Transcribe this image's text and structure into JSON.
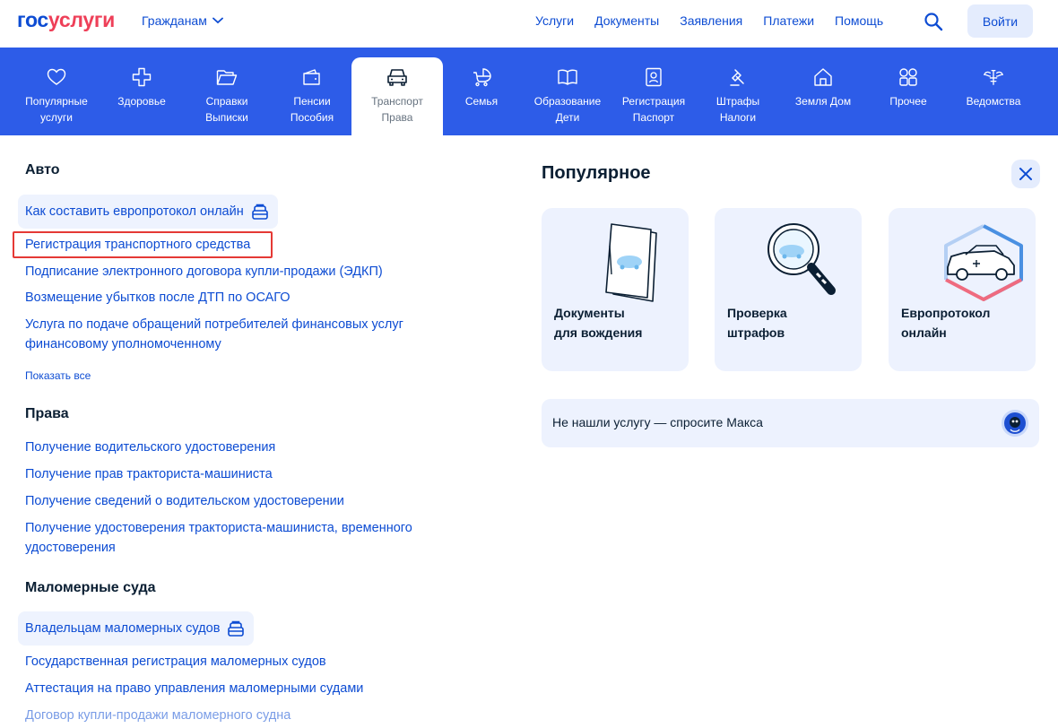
{
  "header": {
    "logo_part1": "гос",
    "logo_part2": "услуги",
    "audience": "Гражданам",
    "nav": [
      "Услуги",
      "Документы",
      "Заявления",
      "Платежи",
      "Помощь"
    ],
    "login": "Войти"
  },
  "categories": [
    {
      "line1": "Популярные",
      "line2": "услуги",
      "icon": "heart-icon"
    },
    {
      "line1": "Здоровье",
      "line2": "",
      "icon": "medical-cross-icon"
    },
    {
      "line1": "Справки",
      "line2": "Выписки",
      "icon": "folder-icon"
    },
    {
      "line1": "Пенсии",
      "line2": "Пособия",
      "icon": "wallet-icon"
    },
    {
      "line1": "Транспорт",
      "line2": "Права",
      "icon": "car-icon",
      "active": true
    },
    {
      "line1": "Семья",
      "line2": "",
      "icon": "stroller-icon"
    },
    {
      "line1": "Образование",
      "line2": "Дети",
      "icon": "book-icon"
    },
    {
      "line1": "Регистрация",
      "line2": "Паспорт",
      "icon": "passport-icon"
    },
    {
      "line1": "Штрафы",
      "line2": "Налоги",
      "icon": "gavel-icon"
    },
    {
      "line1": "Земля Дом",
      "line2": "",
      "icon": "house-icon"
    },
    {
      "line1": "Прочее",
      "line2": "",
      "icon": "grid-icon"
    },
    {
      "line1": "Ведомства",
      "line2": "",
      "icon": "emblem-icon"
    }
  ],
  "auto": {
    "title": "Авто",
    "chip": "Как составить европротокол онлайн",
    "links": [
      "Регистрация транспортного средства",
      "Подписание электронного договора купли-продажи (ЭДКП)",
      "Возмещение убытков после ДТП по ОСАГО",
      "Услуга по подаче обращений потребителей финансовых услуг",
      "финансовому уполномоченному"
    ],
    "show_all": "Показать все"
  },
  "rights": {
    "title": "Права",
    "links": [
      "Получение водительского удостоверения",
      "Получение прав тракториста-машиниста",
      "Получение сведений о водительском удостоверении",
      "Получение удостоверения тракториста-машиниста, временного",
      "удостоверения"
    ]
  },
  "boats": {
    "title": "Маломерные суда",
    "chip": "Владельцам маломерных судов",
    "links": [
      "Государственная регистрация маломерных судов",
      "Аттестация на право управления маломерными судами",
      "Договор купли-продажи маломерного судна"
    ]
  },
  "popular": {
    "title": "Популярное",
    "cards": [
      {
        "label": "Документы\nдля вождения",
        "icon": "documents-illustration"
      },
      {
        "label": "Проверка\nштрафов",
        "icon": "magnifier-illustration"
      },
      {
        "label": "Европротокол\nонлайн",
        "icon": "car-hexagon-illustration"
      }
    ],
    "ask": "Не нашли услугу — спросите Макса"
  },
  "colors": {
    "brand_blue": "#0d4cd3",
    "brand_red": "#ee3f58",
    "catbar": "#2d5ce8",
    "highlight": "#e53935"
  }
}
